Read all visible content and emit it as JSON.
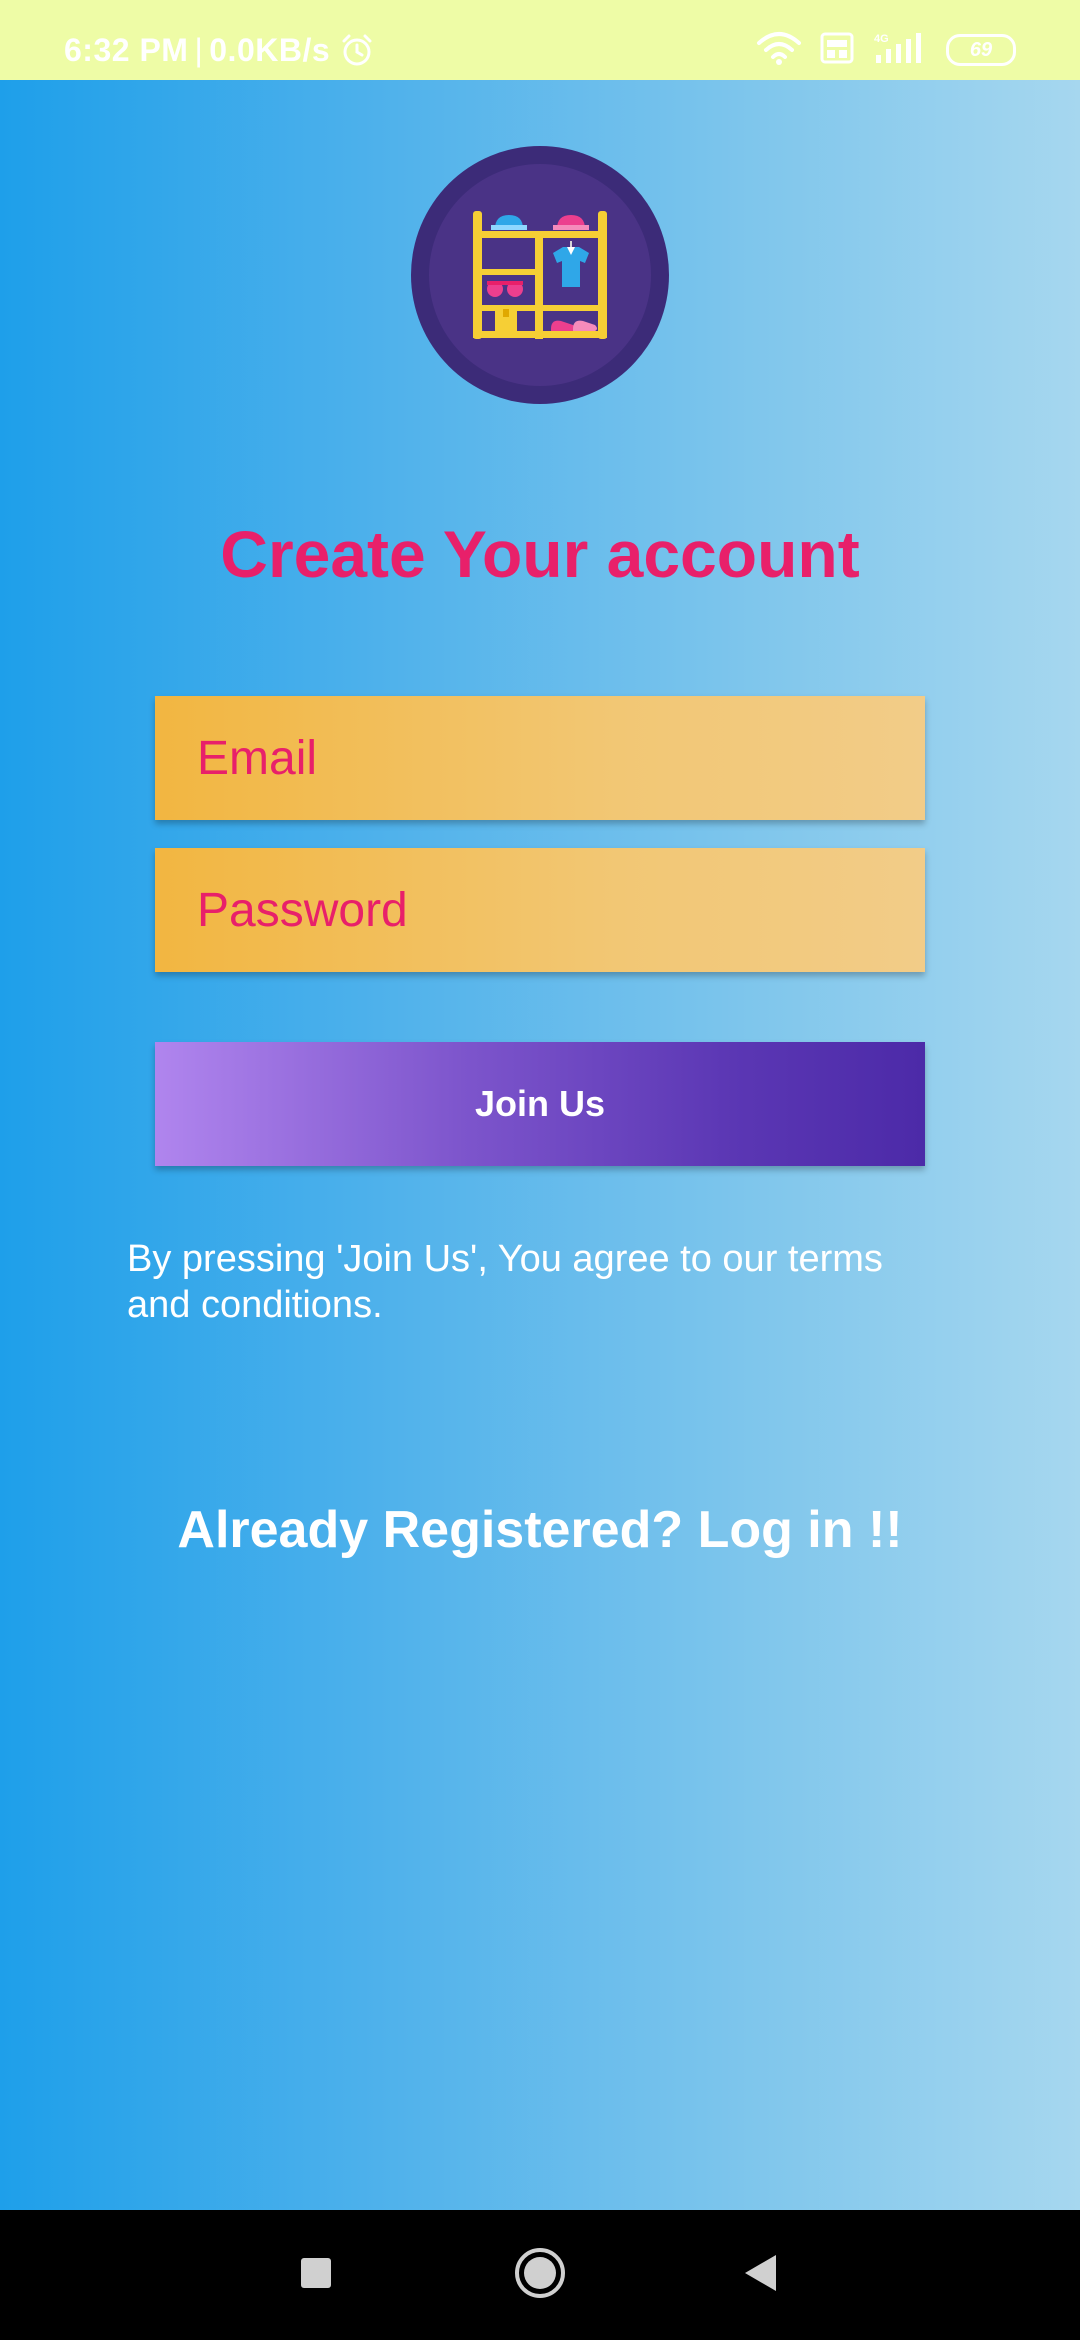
{
  "status_bar": {
    "time": "6:32 PM",
    "separator": "|",
    "network_speed": "0.0KB/s",
    "battery_level": "69",
    "icons": [
      "alarm-icon",
      "wifi-icon",
      "volte-icon",
      "signal-4g-icon",
      "battery-icon"
    ]
  },
  "logo": {
    "icon": "wardrobe-shelf-icon"
  },
  "signup": {
    "title": "Create Your account",
    "email_placeholder": "Email",
    "password_placeholder": "Password",
    "join_label": "Join Us",
    "terms_text": "By pressing 'Join Us', You agree to our terms and conditions.",
    "login_prompt": "Already Registered?  Log in !!"
  },
  "nav_bar": {
    "icons": [
      "recents-icon",
      "home-icon",
      "back-icon"
    ]
  },
  "colors": {
    "status_bar_bg": "#eefca6",
    "title": "#e8206a",
    "field_bg": "#f2b641",
    "button_start": "#b085ee",
    "button_end": "#4c2aa8",
    "background_start": "#1e9fea",
    "background_end": "#a6d7ef"
  }
}
